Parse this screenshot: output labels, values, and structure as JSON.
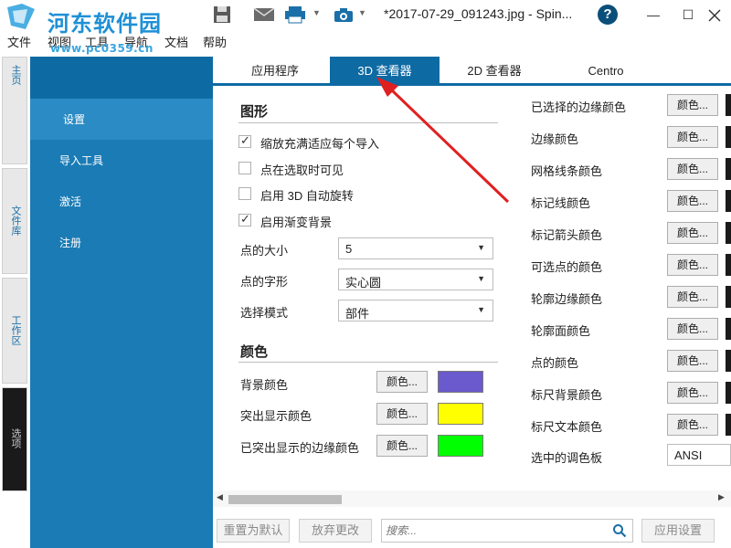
{
  "watermark": {
    "site": "河东软件园",
    "url": "www.pc0359.cn"
  },
  "window": {
    "doc_title": "*2017-07-29_091243.jpg - Spin...",
    "help": "?",
    "minimize": "—",
    "maximize": "☐"
  },
  "menu": [
    "文件",
    "视图",
    "工具",
    "导航",
    "文档",
    "帮助"
  ],
  "vtabs": [
    "主页",
    "文件库",
    "工作区",
    "选项"
  ],
  "sidebar": {
    "items": [
      "设置",
      "导入工具",
      "激活",
      "注册"
    ]
  },
  "tabs": [
    "应用程序",
    "3D 查看器",
    "2D 查看器",
    "Centro"
  ],
  "graphics": {
    "title": "图形",
    "checks": [
      {
        "label": "缩放充满适应每个导入",
        "checked": true
      },
      {
        "label": "点在选取时可见",
        "checked": false
      },
      {
        "label": "启用 3D 自动旋转",
        "checked": false
      },
      {
        "label": "启用渐变背景",
        "checked": true
      }
    ],
    "fields": [
      {
        "label": "点的大小",
        "value": "5"
      },
      {
        "label": "点的字形",
        "value": "实心圆"
      },
      {
        "label": "选择模式",
        "value": "部件"
      }
    ]
  },
  "colors": {
    "title": "颜色",
    "button_label": "颜色...",
    "rows": [
      {
        "label": "背景颜色",
        "swatch": "#6a5acd"
      },
      {
        "label": "突出显示颜色",
        "swatch": "#ffff00"
      },
      {
        "label": "已突出显示的边缘颜色",
        "swatch": "#00ff00"
      }
    ]
  },
  "right_colors": {
    "button_label": "颜色...",
    "rows": [
      "已选择的边缘颜色",
      "边缘颜色",
      "网格线条颜色",
      "标记线颜色",
      "标记箭头颜色",
      "可选点的颜色",
      "轮廓边缘颜色",
      "轮廓面颜色",
      "点的颜色",
      "标尺背景颜色",
      "标尺文本颜色"
    ],
    "palette_label": "选中的调色板",
    "palette_value": "ANSI"
  },
  "bottom": {
    "reset": "重置为默认",
    "discard": "放弃更改",
    "search_placeholder": "搜索...",
    "apply": "应用设置"
  },
  "theme": {
    "accent": "#0e6aa3",
    "sidebar": "#1a7bb5",
    "arrow": "#e02020"
  }
}
